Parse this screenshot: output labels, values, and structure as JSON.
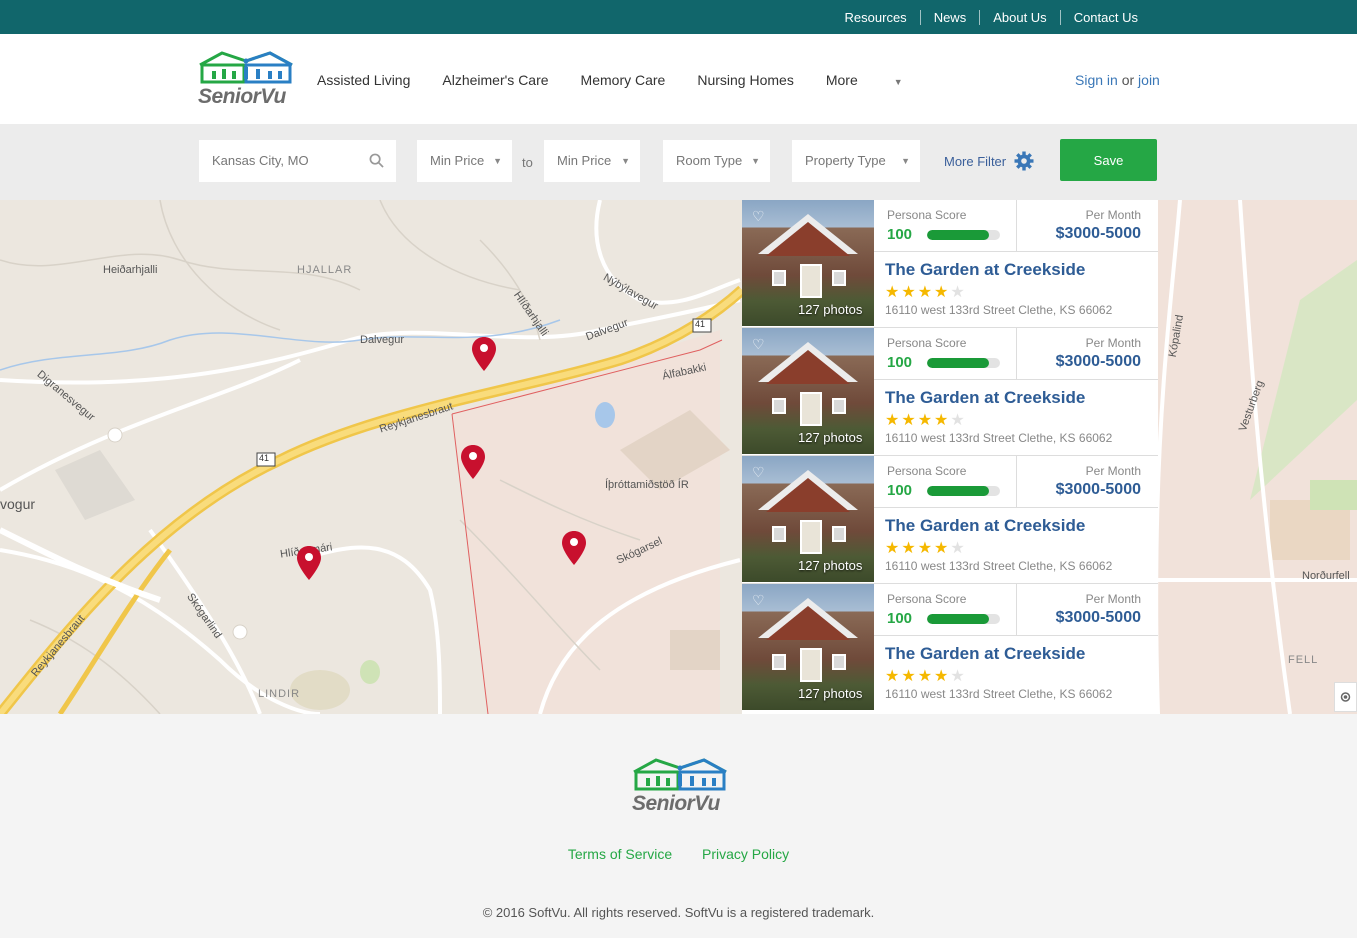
{
  "topbar": {
    "links": [
      "Resources",
      "News",
      "About Us",
      "Contact Us"
    ]
  },
  "brand": {
    "name": "SeniorVu"
  },
  "nav": {
    "items": [
      "Assisted Living",
      "Alzheimer's Care",
      "Memory Care",
      "Nursing Homes"
    ],
    "more_label": "More"
  },
  "auth": {
    "signin": "Sign in",
    "or": "or",
    "join": "join"
  },
  "filters": {
    "location_value": "Kansas City, MO",
    "min_price_1": "Min Price",
    "to_label": "to",
    "min_price_2": "Min Price",
    "room_type": "Room Type",
    "property_type": "Property Type",
    "more_filter": "More Filter",
    "save_label": "Save"
  },
  "map": {
    "labels": [
      "Heiðarhjalli",
      "HJALLAR",
      "Hlíðarhjalli",
      "Dalvegur",
      "Digranesvegur",
      "Reykjanesbraut",
      "Álfabakki",
      "Nýbýlavegur",
      "Íþróttamiðstöð ÍR",
      "Skógarsel",
      "Skógarlind",
      "LINDIR",
      "Hlíðasmári",
      "Vesturberg",
      "Norðurfell",
      "FELL",
      "vogur",
      "Kópalind",
      "41",
      "41"
    ],
    "pin_count": 4
  },
  "listings": [
    {
      "score_label": "Persona Score",
      "score": "100",
      "score_pct": 0.85,
      "price_label": "Per Month",
      "price": "$3000-5000",
      "name": "The Garden at Creekside",
      "rating": 4,
      "address": "16110 west 133rd Street Clethe, KS 66062",
      "photos": "127 photos"
    },
    {
      "score_label": "Persona Score",
      "score": "100",
      "score_pct": 0.85,
      "price_label": "Per Month",
      "price": "$3000-5000",
      "name": "The Garden at Creekside",
      "rating": 4,
      "address": "16110 west 133rd Street Clethe, KS 66062",
      "photos": "127 photos"
    },
    {
      "score_label": "Persona Score",
      "score": "100",
      "score_pct": 0.85,
      "price_label": "Per Month",
      "price": "$3000-5000",
      "name": "The Garden at Creekside",
      "rating": 4,
      "address": "16110 west 133rd Street Clethe, KS 66062",
      "photos": "127 photos"
    },
    {
      "score_label": "Persona Score",
      "score": "100",
      "score_pct": 0.85,
      "price_label": "Per Month",
      "price": "$3000-5000",
      "name": "The Garden at Creekside",
      "rating": 4,
      "address": "16110 west 133rd Street Clethe, KS 66062",
      "photos": "127 photos"
    }
  ],
  "footer": {
    "terms": "Terms of Service",
    "privacy": "Privacy Policy",
    "copyright": "© 2016 SoftVu. All rights reserved. SoftVu is a registered trademark."
  },
  "colors": {
    "topbar": "#11666b",
    "accent_green": "#25a745",
    "link_blue": "#2e5c95",
    "star": "#f5b800",
    "pin": "#c8102e"
  }
}
